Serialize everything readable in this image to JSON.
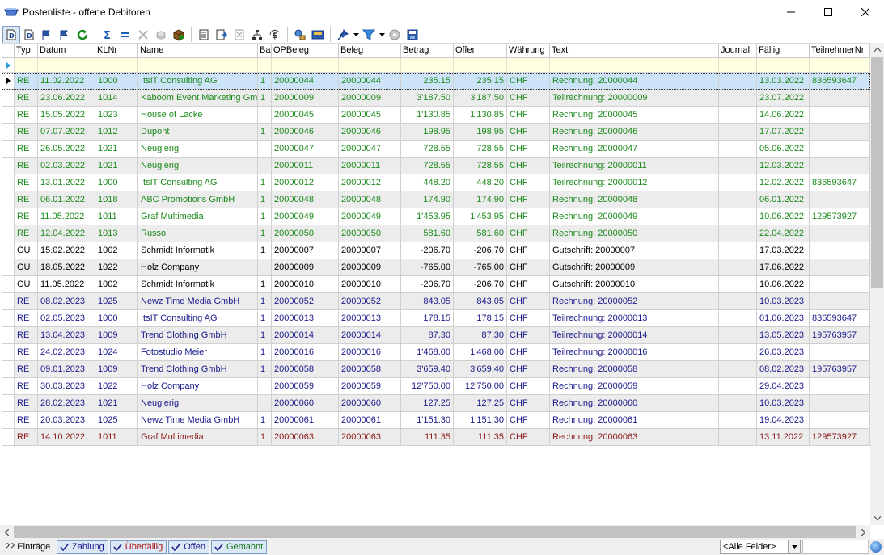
{
  "window": {
    "title": "Postenliste - offene Debitoren",
    "minimize_glyph": "—",
    "maximize_glyph": "☐",
    "close_glyph": "✕"
  },
  "toolbar": {
    "buttons": [
      "debitor-doc-icon",
      "debitor-doc-plus-icon",
      "flag-edit-icon",
      "flag-plus-icon",
      "sum-icon",
      "equals-icon",
      "crossed-tools-icon",
      "coins-icon",
      "box-icon",
      "document-list-icon",
      "document-arrow-icon",
      "document-cross-icon",
      "document-tree-icon",
      "dollar-refresh-icon",
      "network-icon",
      "globe-user-icon",
      "screen-settings-icon",
      "pin-icon",
      "filter-icon",
      "disc-icon",
      "save-icon"
    ]
  },
  "columns": [
    "Typ",
    "Datum",
    "KLNr",
    "Name",
    "Bai",
    "OPBeleg",
    "Beleg",
    "Betrag",
    "Offen",
    "Währung",
    "Text",
    "Journal",
    "Fällig",
    "TeilnehmerNr"
  ],
  "rows": [
    {
      "typ": "RE",
      "datum": "11.02.2022",
      "klnr": "1000",
      "name": "ItsIT Consulting AG",
      "bar": "1",
      "opbeleg": "20000044",
      "beleg": "20000044",
      "betrag": "235.15",
      "offen": "235.15",
      "waehrung": "CHF",
      "text": "Rechnung: 20000044",
      "journal": "",
      "faellig": "13.03.2022",
      "tn": "836593647",
      "color": "green"
    },
    {
      "typ": "RE",
      "datum": "23.06.2022",
      "klnr": "1014",
      "name": "Kaboom Event Marketing Gmb",
      "bar": "1",
      "opbeleg": "20000009",
      "beleg": "20000009",
      "betrag": "3'187.50",
      "offen": "3'187.50",
      "waehrung": "CHF",
      "text": "Teilrechnung: 20000009",
      "journal": "",
      "faellig": "23.07.2022",
      "tn": "",
      "color": "green"
    },
    {
      "typ": "RE",
      "datum": "15.05.2022",
      "klnr": "1023",
      "name": "House of Lacke",
      "bar": "",
      "opbeleg": "20000045",
      "beleg": "20000045",
      "betrag": "1'130.85",
      "offen": "1'130.85",
      "waehrung": "CHF",
      "text": "Rechnung: 20000045",
      "journal": "",
      "faellig": "14.06.2022",
      "tn": "",
      "color": "green"
    },
    {
      "typ": "RE",
      "datum": "07.07.2022",
      "klnr": "1012",
      "name": "Dupont",
      "bar": "1",
      "opbeleg": "20000046",
      "beleg": "20000046",
      "betrag": "198.95",
      "offen": "198.95",
      "waehrung": "CHF",
      "text": "Rechnung: 20000046",
      "journal": "",
      "faellig": "17.07.2022",
      "tn": "",
      "color": "green"
    },
    {
      "typ": "RE",
      "datum": "26.05.2022",
      "klnr": "1021",
      "name": "Neugierig",
      "bar": "",
      "opbeleg": "20000047",
      "beleg": "20000047",
      "betrag": "728.55",
      "offen": "728.55",
      "waehrung": "CHF",
      "text": "Rechnung: 20000047",
      "journal": "",
      "faellig": "05.06.2022",
      "tn": "",
      "color": "green"
    },
    {
      "typ": "RE",
      "datum": "02.03.2022",
      "klnr": "1021",
      "name": "Neugierig",
      "bar": "",
      "opbeleg": "20000011",
      "beleg": "20000011",
      "betrag": "728.55",
      "offen": "728.55",
      "waehrung": "CHF",
      "text": "Teilrechnung: 20000011",
      "journal": "",
      "faellig": "12.03.2022",
      "tn": "",
      "color": "green"
    },
    {
      "typ": "RE",
      "datum": "13.01.2022",
      "klnr": "1000",
      "name": "ItsIT Consulting AG",
      "bar": "1",
      "opbeleg": "20000012",
      "beleg": "20000012",
      "betrag": "448.20",
      "offen": "448.20",
      "waehrung": "CHF",
      "text": "Teilrechnung: 20000012",
      "journal": "",
      "faellig": "12.02.2022",
      "tn": "836593647",
      "color": "green"
    },
    {
      "typ": "RE",
      "datum": "06.01.2022",
      "klnr": "1018",
      "name": "ABC Promotions GmbH",
      "bar": "1",
      "opbeleg": "20000048",
      "beleg": "20000048",
      "betrag": "174.90",
      "offen": "174.90",
      "waehrung": "CHF",
      "text": "Rechnung: 20000048",
      "journal": "",
      "faellig": "06.01.2022",
      "tn": "",
      "color": "green"
    },
    {
      "typ": "RE",
      "datum": "11.05.2022",
      "klnr": "1011",
      "name": "Graf Multimedia",
      "bar": "1",
      "opbeleg": "20000049",
      "beleg": "20000049",
      "betrag": "1'453.95",
      "offen": "1'453.95",
      "waehrung": "CHF",
      "text": "Rechnung: 20000049",
      "journal": "",
      "faellig": "10.06.2022",
      "tn": "129573927",
      "color": "green"
    },
    {
      "typ": "RE",
      "datum": "12.04.2022",
      "klnr": "1013",
      "name": "Russo",
      "bar": "1",
      "opbeleg": "20000050",
      "beleg": "20000050",
      "betrag": "581.60",
      "offen": "581.60",
      "waehrung": "CHF",
      "text": "Rechnung: 20000050",
      "journal": "",
      "faellig": "22.04.2022",
      "tn": "",
      "color": "green"
    },
    {
      "typ": "GU",
      "datum": "15.02.2022",
      "klnr": "1002",
      "name": "Schmidt Informatik",
      "bar": "1",
      "opbeleg": "20000007",
      "beleg": "20000007",
      "betrag": "-206.70",
      "offen": "-206.70",
      "waehrung": "CHF",
      "text": "Gutschrift: 20000007",
      "journal": "",
      "faellig": "17.03.2022",
      "tn": "",
      "color": "black"
    },
    {
      "typ": "GU",
      "datum": "18.05.2022",
      "klnr": "1022",
      "name": "Holz Company",
      "bar": "",
      "opbeleg": "20000009",
      "beleg": "20000009",
      "betrag": "-765.00",
      "offen": "-765.00",
      "waehrung": "CHF",
      "text": "Gutschrift: 20000009",
      "journal": "",
      "faellig": "17.06.2022",
      "tn": "",
      "color": "black"
    },
    {
      "typ": "GU",
      "datum": "11.05.2022",
      "klnr": "1002",
      "name": "Schmidt Informatik",
      "bar": "1",
      "opbeleg": "20000010",
      "beleg": "20000010",
      "betrag": "-206.70",
      "offen": "-206.70",
      "waehrung": "CHF",
      "text": "Gutschrift: 20000010",
      "journal": "",
      "faellig": "10.06.2022",
      "tn": "",
      "color": "black"
    },
    {
      "typ": "RE",
      "datum": "08.02.2023",
      "klnr": "1025",
      "name": "Newz Time Media GmbH",
      "bar": "1",
      "opbeleg": "20000052",
      "beleg": "20000052",
      "betrag": "843.05",
      "offen": "843.05",
      "waehrung": "CHF",
      "text": "Rechnung: 20000052",
      "journal": "",
      "faellig": "10.03.2023",
      "tn": "",
      "color": "blue"
    },
    {
      "typ": "RE",
      "datum": "02.05.2023",
      "klnr": "1000",
      "name": "ItsIT Consulting AG",
      "bar": "1",
      "opbeleg": "20000013",
      "beleg": "20000013",
      "betrag": "178.15",
      "offen": "178.15",
      "waehrung": "CHF",
      "text": "Teilrechnung: 20000013",
      "journal": "",
      "faellig": "01.06.2023",
      "tn": "836593647",
      "color": "blue"
    },
    {
      "typ": "RE",
      "datum": "13.04.2023",
      "klnr": "1009",
      "name": "Trend Clothing GmbH",
      "bar": "1",
      "opbeleg": "20000014",
      "beleg": "20000014",
      "betrag": "87.30",
      "offen": "87.30",
      "waehrung": "CHF",
      "text": "Teilrechnung: 20000014",
      "journal": "",
      "faellig": "13.05.2023",
      "tn": "195763957",
      "color": "blue"
    },
    {
      "typ": "RE",
      "datum": "24.02.2023",
      "klnr": "1024",
      "name": "Fotostudio Meier",
      "bar": "1",
      "opbeleg": "20000016",
      "beleg": "20000016",
      "betrag": "1'468.00",
      "offen": "1'468.00",
      "waehrung": "CHF",
      "text": "Teilrechnung: 20000016",
      "journal": "",
      "faellig": "26.03.2023",
      "tn": "",
      "color": "blue"
    },
    {
      "typ": "RE",
      "datum": "09.01.2023",
      "klnr": "1009",
      "name": "Trend Clothing GmbH",
      "bar": "1",
      "opbeleg": "20000058",
      "beleg": "20000058",
      "betrag": "3'659.40",
      "offen": "3'659.40",
      "waehrung": "CHF",
      "text": "Rechnung: 20000058",
      "journal": "",
      "faellig": "08.02.2023",
      "tn": "195763957",
      "color": "blue"
    },
    {
      "typ": "RE",
      "datum": "30.03.2023",
      "klnr": "1022",
      "name": "Holz Company",
      "bar": "",
      "opbeleg": "20000059",
      "beleg": "20000059",
      "betrag": "12'750.00",
      "offen": "12'750.00",
      "waehrung": "CHF",
      "text": "Rechnung: 20000059",
      "journal": "",
      "faellig": "29.04.2023",
      "tn": "",
      "color": "blue"
    },
    {
      "typ": "RE",
      "datum": "28.02.2023",
      "klnr": "1021",
      "name": "Neugierig",
      "bar": "",
      "opbeleg": "20000060",
      "beleg": "20000060",
      "betrag": "127.25",
      "offen": "127.25",
      "waehrung": "CHF",
      "text": "Rechnung: 20000060",
      "journal": "",
      "faellig": "10.03.2023",
      "tn": "",
      "color": "blue"
    },
    {
      "typ": "RE",
      "datum": "20.03.2023",
      "klnr": "1025",
      "name": "Newz Time Media GmbH",
      "bar": "1",
      "opbeleg": "20000061",
      "beleg": "20000061",
      "betrag": "1'151.30",
      "offen": "1'151.30",
      "waehrung": "CHF",
      "text": "Rechnung: 20000061",
      "journal": "",
      "faellig": "19.04.2023",
      "tn": "",
      "color": "blue"
    },
    {
      "typ": "RE",
      "datum": "14.10.2022",
      "klnr": "1011",
      "name": "Graf Multimedia",
      "bar": "1",
      "opbeleg": "20000063",
      "beleg": "20000063",
      "betrag": "111.35",
      "offen": "111.35",
      "waehrung": "CHF",
      "text": "Rechnung: 20000063",
      "journal": "",
      "faellig": "13.11.2022",
      "tn": "129573927",
      "color": "red"
    }
  ],
  "status": {
    "count": "22 Einträge",
    "chips": [
      {
        "label": "Zahlung",
        "color": "#1a1a8c"
      },
      {
        "label": "Überfällig",
        "color": "#b01010"
      },
      {
        "label": "Offen",
        "color": "#1a1a8c"
      },
      {
        "label": "Gemahnt",
        "color": "#1c7a1c"
      }
    ],
    "field_select": "<Alle Felder>"
  },
  "colors": {
    "green": "#1c8a1c",
    "black": "#000000",
    "blue": "#1a1a8c",
    "red": "#8c1a1a",
    "selected_row": "#cce3f8"
  }
}
